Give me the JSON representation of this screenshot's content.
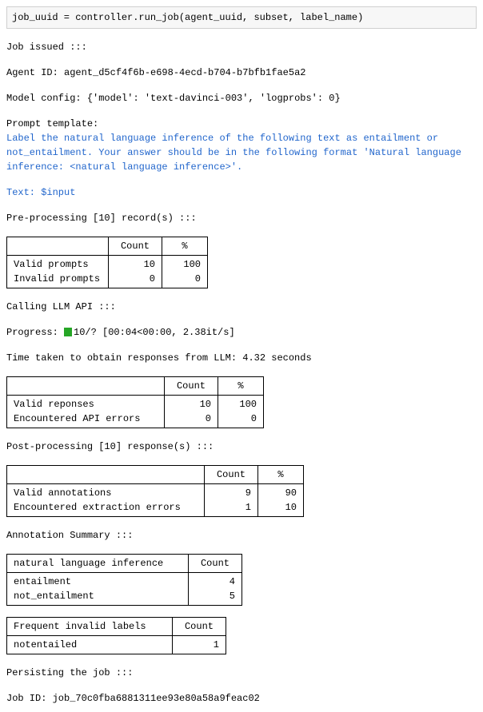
{
  "code_line": "job_uuid = controller.run_job(agent_uuid, subset, label_name)",
  "job_issued_header": "Job issued :::",
  "agent_id_label": "Agent ID: ",
  "agent_id": "agent_d5cf4f6b-e698-4ecd-b704-b7bfb1fae5a2",
  "model_config_label": "Model config: ",
  "model_config": "{'model': 'text-davinci-003', 'logprobs': 0}",
  "prompt_template_label": "Prompt template:",
  "prompt_template_text": "Label the natural language inference of the following text as entailment or not_entailment. Your answer should be in the following format 'Natural language inference: <natural language inference>'.",
  "prompt_text_line": "Text: $input",
  "preproc_header": "Pre-processing [10] record(s) :::",
  "preproc_table": {
    "cols": [
      "",
      "Count",
      "%"
    ],
    "rows": [
      [
        "Valid prompts",
        "10",
        "100"
      ],
      [
        "Invalid prompts",
        "0",
        "0"
      ]
    ]
  },
  "calling_header": "Calling LLM API :::",
  "progress_label": "Progress: ",
  "progress_text": "10/? [00:04<00:00, 2.38it/s]",
  "time_taken": "Time taken to obtain responses from LLM: 4.32 seconds",
  "resp_table": {
    "cols": [
      "",
      "Count",
      "%"
    ],
    "rows": [
      [
        "Valid reponses",
        "10",
        "100"
      ],
      [
        "Encountered API errors",
        "0",
        "0"
      ]
    ]
  },
  "postproc_header": "Post-processing [10] response(s) :::",
  "post_table": {
    "cols": [
      "",
      "Count",
      "%"
    ],
    "rows": [
      [
        "Valid annotations",
        "9",
        "90"
      ],
      [
        "Encountered extraction errors",
        "1",
        "10"
      ]
    ]
  },
  "ann_header": "Annotation Summary :::",
  "ann_table": {
    "cols": [
      "natural language inference",
      "Count"
    ],
    "rows": [
      [
        "entailment",
        "4"
      ],
      [
        "not_entailment",
        "5"
      ]
    ]
  },
  "invalid_table": {
    "cols": [
      "Frequent invalid labels",
      "Count"
    ],
    "rows": [
      [
        "notentailed",
        "1"
      ]
    ]
  },
  "persist_header": "Persisting the job :::",
  "job_id_label": "Job ID: ",
  "job_id": "job_70c0fba6881311ee93e80a58a9feac02"
}
